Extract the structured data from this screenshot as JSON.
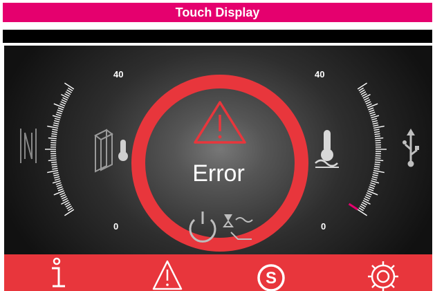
{
  "title": "Touch Display",
  "status": {
    "text": "Error",
    "accent": "#e8363c"
  },
  "gauges": {
    "left": {
      "max_label": "40",
      "min_label": "0",
      "icon": "ambient-temperature-icon"
    },
    "right": {
      "max_label": "40",
      "min_label": "0",
      "icon": "bath-temperature-icon",
      "level": 0.0
    }
  },
  "side_icons": {
    "left": "nfc-icon",
    "right": "usb-icon"
  },
  "center_icon": "standby-pump-icon",
  "bottom_bar": {
    "color": "#e8363c",
    "buttons": [
      "info-icon",
      "warning-icon",
      "safety-icon",
      "settings-icon"
    ]
  },
  "colors": {
    "title_bar": "#e5006e",
    "ring": "#e8363c"
  }
}
